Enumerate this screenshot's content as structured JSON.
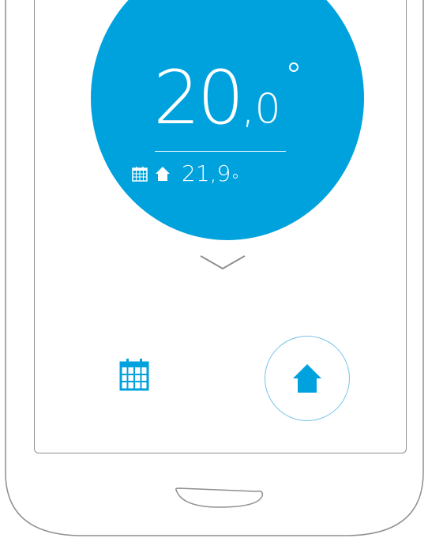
{
  "thermostat": {
    "current_temp_integer": "20",
    "current_temp_decimal": ",0",
    "setpoint_value": "21,9",
    "schedule_icon": "calendar-icon",
    "home_icon": "home-icon",
    "expand_icon": "chevron-down-icon"
  },
  "controls": {
    "schedule_icon": "calendar-icon",
    "home_icon": "home-icon"
  },
  "colors": {
    "accent": "#00a2de",
    "accent_light": "#78c3ea",
    "outline": "#8f8f8f",
    "background": "#ffffff"
  }
}
